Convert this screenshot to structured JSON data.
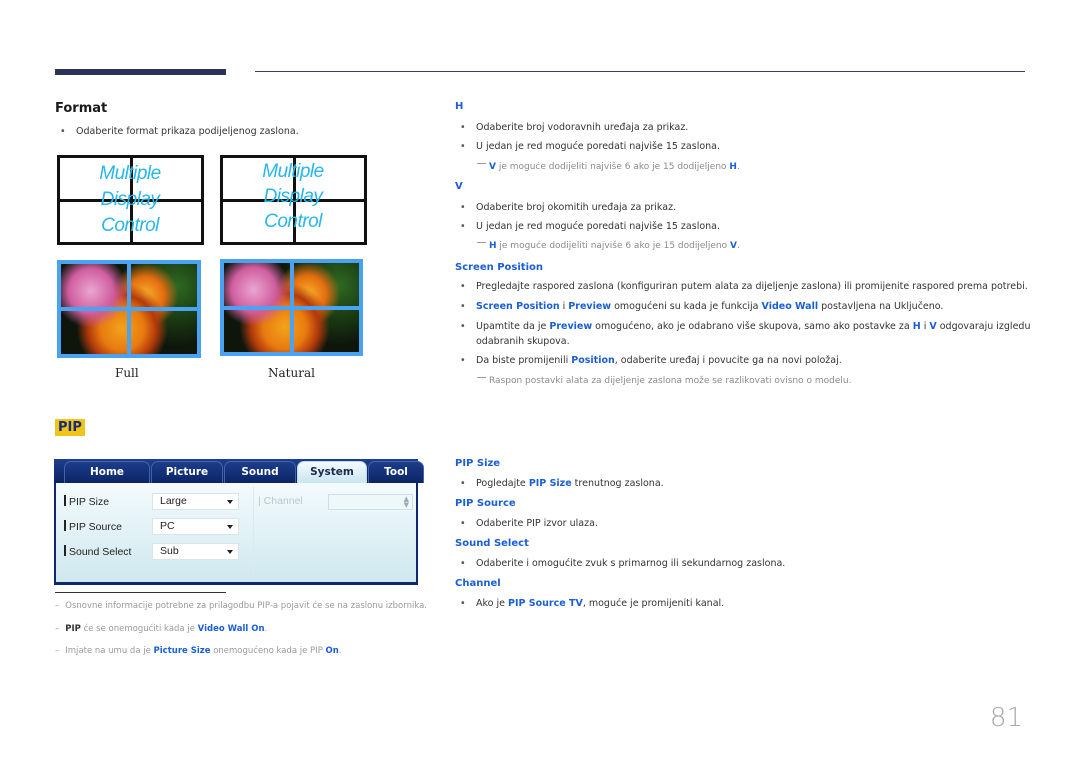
{
  "format": {
    "title": "Format",
    "bullet": "Odaberite format prikaza podijeljenog zaslona.",
    "logo_lines": [
      "Multiple",
      "Display",
      "Control"
    ],
    "captions": {
      "full": "Full",
      "natural": "Natural"
    }
  },
  "h_section": {
    "title": "H",
    "bullets": [
      "Odaberite broj vodoravnih uređaja za prikaz.",
      "U jedan je red moguće poredati najviše 15 zaslona."
    ],
    "note": {
      "lead": "V",
      "text": " je moguće dodijeliti najviše 6 ako je 15 dodijeljeno ",
      "tail": "H",
      "end": "."
    }
  },
  "v_section": {
    "title": "V",
    "bullets": [
      "Odaberite broj okomitih uređaja za prikaz.",
      "U jedan je red moguće poredati najviše 15 zaslona."
    ],
    "note": {
      "lead": "H",
      "text": " je moguće dodijeliti najviše 6 ako je 15 dodijeljeno ",
      "tail": "V",
      "end": "."
    }
  },
  "screen_position": {
    "title": "Screen Position",
    "b1": "Pregledajte raspored zaslona (konfiguriran putem alata za dijeljenje zaslona) ili promijenite raspored prema potrebi.",
    "b2": {
      "k1": "Screen Position",
      "t1": " i ",
      "k2": "Preview",
      "t2": " omogućeni su kada je funkcija ",
      "k3": "Video Wall",
      "t3": " postavljena na Uključeno."
    },
    "b3": {
      "t1": "Upamtite da je ",
      "k1": "Preview",
      "t2": " omogućeno, ako je odabrano više skupova, samo ako postavke za ",
      "k2": "H",
      "t3": " i ",
      "k3": "V",
      "t4": " odgovaraju izgledu",
      "line2": "odabranih skupova."
    },
    "b4": {
      "t1": "Da biste promijenili ",
      "k1": "Position",
      "t2": ", odaberite uređaj i povucite ga na novi položaj."
    },
    "note": "Raspon postavki alata za dijeljenje zaslona može se razlikovati ovisno o modelu."
  },
  "pip": {
    "badge": "PIP",
    "app": {
      "tabs": [
        "Home",
        "Picture",
        "Sound",
        "System",
        "Tool"
      ],
      "active_tab": "System",
      "fields": [
        {
          "label": "PIP Size",
          "value": "Large"
        },
        {
          "label": "PIP Source",
          "value": "PC"
        },
        {
          "label": "Sound Select",
          "value": "Sub"
        }
      ],
      "channel_label": "Channel",
      "channel_value": ""
    },
    "desc": {
      "pip_size": {
        "title": "PIP Size",
        "t1": "Pogledajte ",
        "k1": "PIP Size",
        "t2": " trenutnog zaslona."
      },
      "pip_source": {
        "title": "PIP Source",
        "text": "Odaberite PIP izvor ulaza."
      },
      "sound_select": {
        "title": "Sound Select",
        "text": "Odaberite i omogućite zvuk s primarnog ili sekundarnog zaslona."
      },
      "channel": {
        "title": "Channel",
        "t1": "Ako je ",
        "k1": "PIP Source TV",
        "t2": ", moguće je promijeniti kanal."
      }
    },
    "footnotes": {
      "f1": "Osnovne informacije potrebne za prilagodbu PIP-a pojavit će se na zaslonu izbornika.",
      "f2": {
        "k1": "PIP",
        "t1": " će se onemogućiti kada je ",
        "k2": "Video Wall On",
        "t2": "."
      },
      "f3": {
        "t1": "Imjate na umu da je ",
        "k1": "Picture Size",
        "t2": " onemogućeno kada je PIP ",
        "k2": "On",
        "t3": "."
      }
    }
  },
  "page_number": "81"
}
